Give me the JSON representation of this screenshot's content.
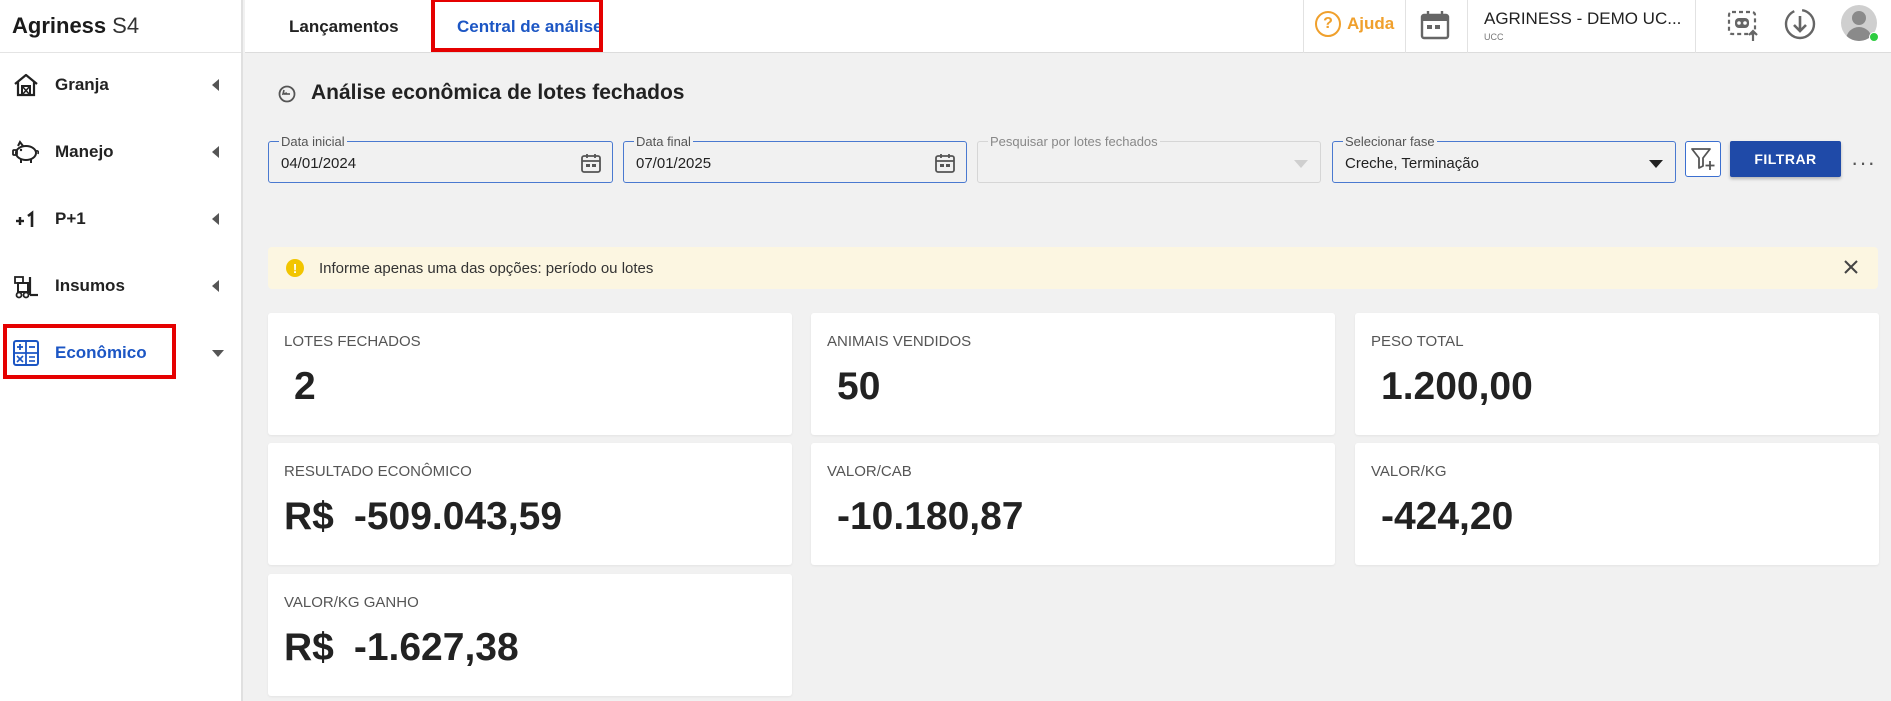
{
  "app": {
    "brand": "Agriness",
    "brand_suffix": "S4"
  },
  "sidebar": {
    "items": [
      {
        "label": "Granja",
        "icon": "farm-house-icon"
      },
      {
        "label": "Manejo",
        "icon": "pig-icon"
      },
      {
        "label": "P+1",
        "icon": "plus-one-icon"
      },
      {
        "label": "Insumos",
        "icon": "forklift-icon"
      },
      {
        "label": "Econômico",
        "icon": "calculator-icon",
        "active": true
      }
    ]
  },
  "topbar": {
    "tabs": [
      {
        "label": "Lançamentos"
      },
      {
        "label": "Central de análise",
        "active": true
      }
    ],
    "help_label": "Ajuda",
    "org_name": "AGRINESS - DEMO UC...",
    "org_sub": "UCC"
  },
  "page": {
    "title": "Análise econômica de lotes fechados"
  },
  "filters": {
    "start_date": {
      "label": "Data inicial",
      "value": "04/01/2024"
    },
    "end_date": {
      "label": "Data final",
      "value": "07/01/2025"
    },
    "lot_search": {
      "label": "Pesquisar por lotes fechados",
      "value": ""
    },
    "phase": {
      "label": "Selecionar fase",
      "value": "Creche, Terminação"
    },
    "filter_button": "FILTRAR",
    "more": "···"
  },
  "alert": {
    "text": "Informe apenas uma das opções: período ou lotes"
  },
  "cards": [
    {
      "label": "LOTES FECHADOS",
      "value": "2",
      "currency": ""
    },
    {
      "label": "ANIMAIS VENDIDOS",
      "value": "50",
      "currency": ""
    },
    {
      "label": "PESO TOTAL",
      "value": "1.200,00",
      "currency": ""
    },
    {
      "label": "RESULTADO ECONÔMICO",
      "value": "-509.043,59",
      "currency": "R$"
    },
    {
      "label": "VALOR/CAB",
      "value": "-10.180,87",
      "currency": ""
    },
    {
      "label": "VALOR/KG",
      "value": "-424,20",
      "currency": ""
    },
    {
      "label": "VALOR/KG GANHO",
      "value": "-1.627,38",
      "currency": "R$"
    }
  ],
  "colors": {
    "accent": "#1c56c4",
    "highlight": "#e50000",
    "help": "#f0a02c",
    "primary_button": "#1f4aa8",
    "alert_bg": "#fcf6e1"
  }
}
